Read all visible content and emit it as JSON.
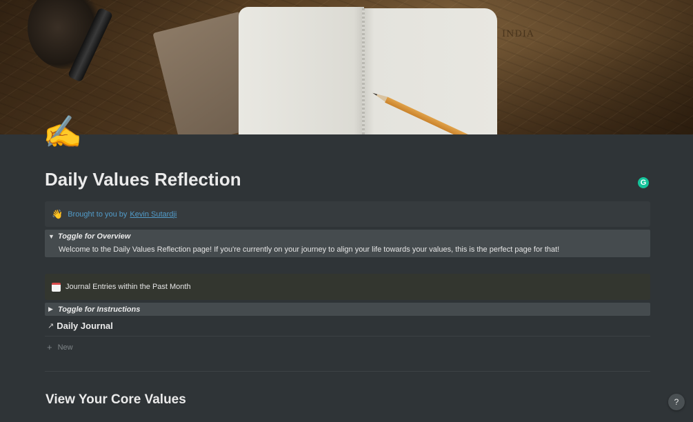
{
  "page": {
    "icon": "✍️",
    "title": "Daily Values Reflection"
  },
  "cover": {
    "map_labels": [
      "INDIA"
    ]
  },
  "callout": {
    "emoji": "👋",
    "text": "Brought to you by",
    "link_text": "Kevin Sutardji",
    "color": "#529cca"
  },
  "overview_toggle": {
    "title": "Toggle for Overview",
    "expanded": true,
    "body": "Welcome to the Daily Values Reflection page! If you're currently on your journey to align your life towards your values, this is the perfect page for that!"
  },
  "journal_callout": {
    "icon": "calendar-icon",
    "text": "Journal Entries within the Past Month"
  },
  "instructions_toggle": {
    "title": "Toggle for Instructions",
    "expanded": false
  },
  "linked_database": {
    "arrow": "↗",
    "title": "Daily Journal",
    "new_label": "New",
    "new_icon": "+"
  },
  "section": {
    "heading": "View Your Core Values"
  },
  "help": {
    "label": "?"
  },
  "grammarly": {
    "label": "G",
    "color": "#15c39a"
  }
}
